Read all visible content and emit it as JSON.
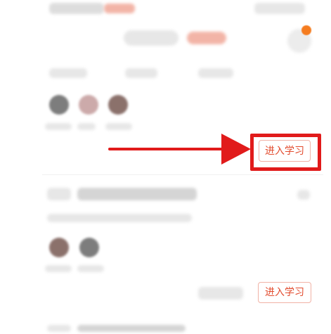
{
  "course_cards": [
    {
      "action_label": "进入学习",
      "highlighted": true
    },
    {
      "action_label": "进入学习",
      "highlighted": false
    }
  ],
  "annotation": {
    "highlight_color": "#e11b1b",
    "arrow_color": "#e11b1b"
  },
  "notification": {
    "badge_color": "#f57c1f"
  }
}
